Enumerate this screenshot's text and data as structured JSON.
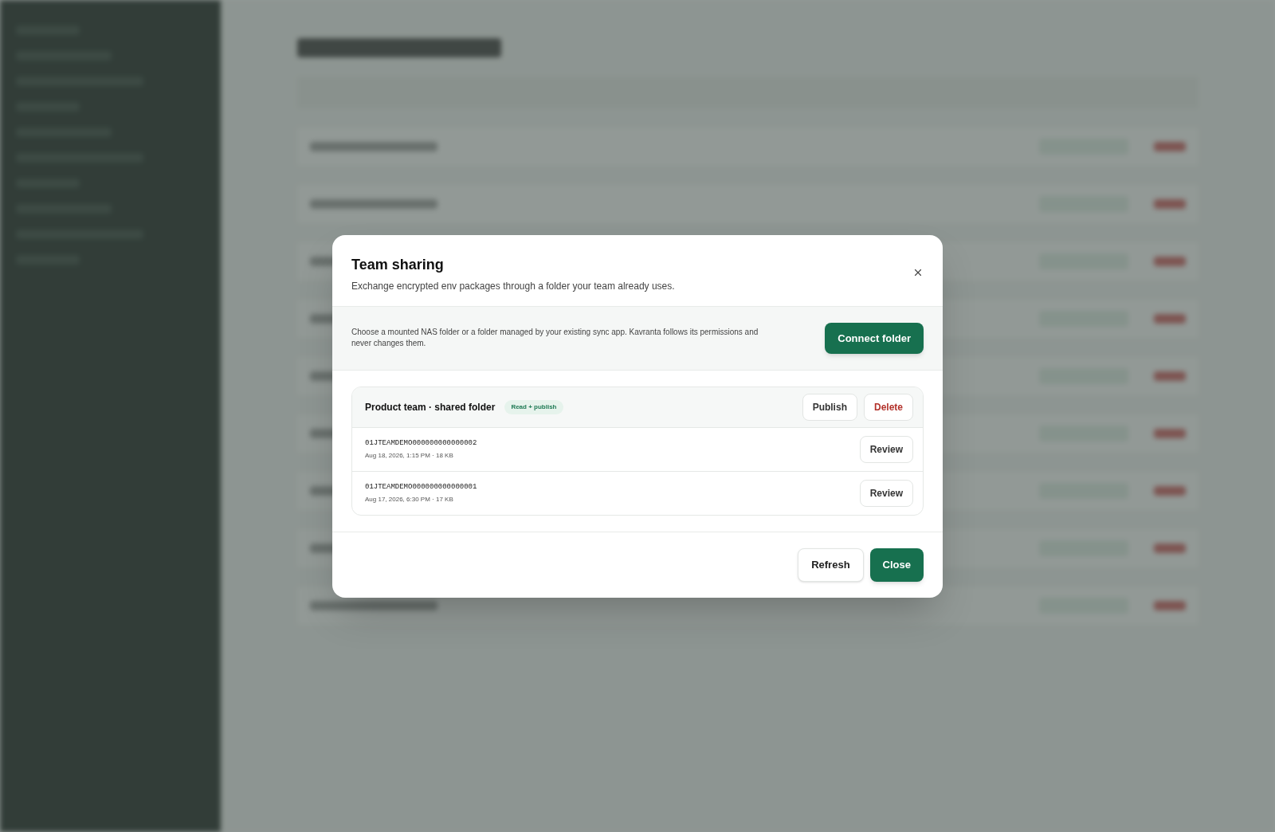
{
  "dialog": {
    "title": "Team sharing",
    "subtitle": "Exchange encrypted env packages through a folder your team already uses.",
    "notice": "Choose a mounted NAS folder or a folder managed by your existing sync app. Kavranta follows its permissions and never changes them.",
    "connect_button": "Connect folder",
    "folder": {
      "name": "Product team · shared folder",
      "badge": "Read + publish",
      "actions": [
        "Publish",
        "Delete"
      ]
    },
    "packages": [
      {
        "id": "01JTEAMDEMO000000000000002",
        "meta": "Aug 18, 2026, 1:15 PM · 18 KB",
        "action": "Review"
      },
      {
        "id": "01JTEAMDEMO000000000000001",
        "meta": "Aug 17, 2026, 6:30 PM · 17 KB",
        "action": "Review"
      }
    ],
    "footer_buttons": [
      {
        "label": "Refresh",
        "kind": "secondary"
      },
      {
        "label": "Close",
        "kind": "primary"
      }
    ]
  }
}
